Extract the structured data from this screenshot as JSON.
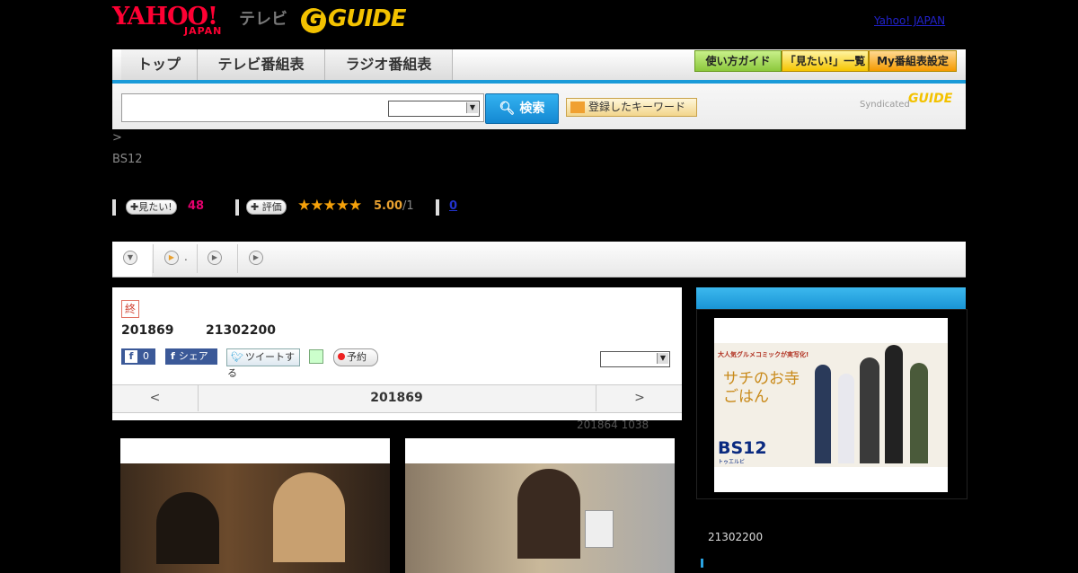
{
  "header": {
    "logo_yahoo": "YAHOO!",
    "logo_japan": "JAPAN",
    "logo_tv": "テレビ",
    "logo_gguide": "GUIDE",
    "yahoo_japan_link": "Yahoo! JAPAN"
  },
  "nav": {
    "tabs": [
      "トップ",
      "テレビ番組表",
      "ラジオ番組表"
    ],
    "right_buttons": [
      "使い方ガイド",
      "「見たい!」一覧",
      "My番組表設定"
    ]
  },
  "search": {
    "input_value": "",
    "select_value": "",
    "button_label": "検索",
    "keyword_button_label": "登録したキーワード",
    "syndicated_label": "Syndicated",
    "syndicated_logo": "GUIDE"
  },
  "info": {
    "breadcrumb": ">",
    "channel": "BS12",
    "mitai_label": "見たい!",
    "mitai_count": "48",
    "hyoka_label": "評価",
    "stars": "★★★★★",
    "score": "5.00",
    "score_den": "/1",
    "comment_count": "0"
  },
  "tabs_bar": {
    "tab2_text": "."
  },
  "program": {
    "end_badge": "終",
    "date": "201869",
    "time": "21302200",
    "fb_count": "0",
    "fb_share": "シェア",
    "tweet": "ツイートする",
    "yoyaku": "予約",
    "nav_prev": "<",
    "nav_date": "201869",
    "nav_next": ">",
    "update_note": "201864  1038"
  },
  "side": {
    "time": "21302200",
    "promo_text": [
      "大人気グルメコミックが実写化!",
      "サチのお寺ごはん"
    ],
    "promo_logo": "BS12",
    "promo_logo_sub": "トゥエルビ"
  },
  "colors": {
    "accent_blue": "#1a9ad8",
    "mitai_pink": "#e6006e",
    "star_orange": "#f5a10a",
    "yahoo_red": "#ff0033",
    "guide_yellow": "#f3c200"
  }
}
